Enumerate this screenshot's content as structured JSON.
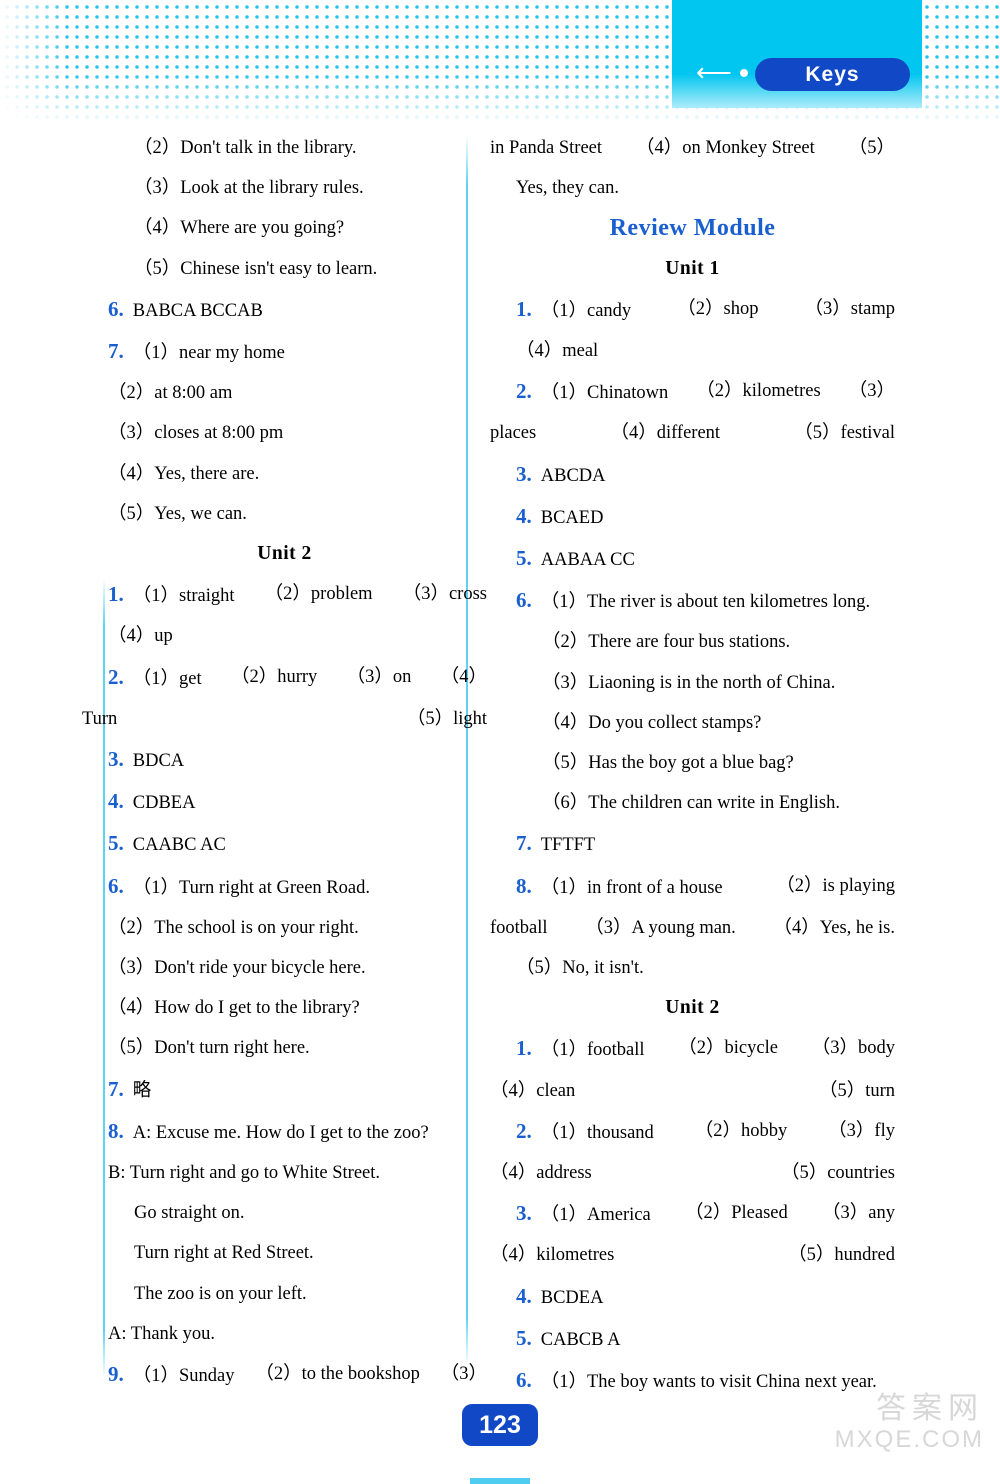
{
  "header": {
    "keys_label": "Keys",
    "back_icon": "back-arrow-icon",
    "accent_cyan": "#00c6f0",
    "accent_blue": "#1148c6"
  },
  "page_number": "123",
  "watermark": {
    "chinese": "答案网",
    "english": "MXQE.COM"
  },
  "left_column": [
    {
      "type": "line",
      "indent": 1,
      "text": "（2）Don't talk in the library."
    },
    {
      "type": "line",
      "indent": 1,
      "text": "（3）Look at the library rules."
    },
    {
      "type": "line",
      "indent": 1,
      "text": "（4）Where are you going?"
    },
    {
      "type": "line",
      "indent": 1,
      "text": "（5）Chinese isn't easy to learn."
    },
    {
      "type": "numbered",
      "num": "6.",
      "text": "BABCA   BCCAB"
    },
    {
      "type": "numbered",
      "num": "7.",
      "text": "（1）near my home"
    },
    {
      "type": "line",
      "indent": 0,
      "text": "（2）at 8:00 am"
    },
    {
      "type": "line",
      "indent": 0,
      "text": "（3）closes at 8:00 pm"
    },
    {
      "type": "line",
      "indent": 0,
      "text": "（4）Yes, there are."
    },
    {
      "type": "line",
      "indent": 0,
      "text": "（5）Yes, we can."
    },
    {
      "type": "unit",
      "text": "Unit 2"
    },
    {
      "type": "numbered-just",
      "num": "1.",
      "parts": [
        "（1）straight",
        "（2）problem",
        "（3）cross"
      ]
    },
    {
      "type": "line",
      "indent": 0,
      "text": "（4）up"
    },
    {
      "type": "numbered-just",
      "num": "2.",
      "parts": [
        "（1）get",
        "（2）hurry",
        "（3）on",
        "（4）"
      ]
    },
    {
      "type": "just2",
      "parts": [
        "Turn",
        "（5）light"
      ]
    },
    {
      "type": "numbered",
      "num": "3.",
      "text": "BDCA"
    },
    {
      "type": "numbered",
      "num": "4.",
      "text": "CDBEA"
    },
    {
      "type": "numbered",
      "num": "5.",
      "text": "CAABC   AC"
    },
    {
      "type": "numbered",
      "num": "6.",
      "text": "（1）Turn right at Green Road."
    },
    {
      "type": "line",
      "indent": 0,
      "text": "（2）The school is on your right."
    },
    {
      "type": "line",
      "indent": 0,
      "text": "（3）Don't ride your bicycle here."
    },
    {
      "type": "line",
      "indent": 0,
      "text": "（4）How do I get to the library?"
    },
    {
      "type": "line",
      "indent": 0,
      "text": "（5）Don't turn right here."
    },
    {
      "type": "numbered",
      "num": "7.",
      "text": "略"
    },
    {
      "type": "numbered",
      "num": "8.",
      "text": "A: Excuse me. How do I get to the zoo?"
    },
    {
      "type": "line",
      "indent": 0,
      "text": "B: Turn right and go to White Street."
    },
    {
      "type": "line",
      "indent": 1,
      "text": "Go straight on."
    },
    {
      "type": "line",
      "indent": 1,
      "text": "Turn right at Red Street."
    },
    {
      "type": "line",
      "indent": 1,
      "text": "The zoo is on your left."
    },
    {
      "type": "line",
      "indent": 0,
      "text": "A: Thank you."
    },
    {
      "type": "numbered-just",
      "num": "9.",
      "parts": [
        "（1）Sunday",
        "（2）to the bookshop",
        "（3）"
      ]
    }
  ],
  "right_column": [
    {
      "type": "just2",
      "parts": [
        "in Panda Street",
        "（4）on Monkey Street",
        "（5）"
      ]
    },
    {
      "type": "line",
      "indent": 0,
      "text": "Yes, they can."
    },
    {
      "type": "module",
      "text": "Review Module"
    },
    {
      "type": "unit",
      "text": "Unit 1"
    },
    {
      "type": "numbered-just",
      "num": "1.",
      "parts": [
        "（1）candy",
        "（2）shop",
        "（3）stamp"
      ]
    },
    {
      "type": "line",
      "indent": 0,
      "text": "（4）meal"
    },
    {
      "type": "numbered-just",
      "num": "2.",
      "parts": [
        "（1）Chinatown",
        "（2）kilometres",
        "（3）"
      ]
    },
    {
      "type": "just2",
      "parts": [
        "places",
        "（4）different",
        "（5）festival"
      ]
    },
    {
      "type": "numbered",
      "num": "3.",
      "text": "ABCDA"
    },
    {
      "type": "numbered",
      "num": "4.",
      "text": "BCAED"
    },
    {
      "type": "numbered",
      "num": "5.",
      "text": "AABAA CC"
    },
    {
      "type": "numbered",
      "num": "6.",
      "text": "（1）The river is about ten kilometres long."
    },
    {
      "type": "line",
      "indent": 1,
      "text": "（2）There are four bus stations."
    },
    {
      "type": "line",
      "indent": 1,
      "text": "（3）Liaoning is in the north of China."
    },
    {
      "type": "line",
      "indent": 1,
      "text": "（4）Do you collect stamps?"
    },
    {
      "type": "line",
      "indent": 1,
      "text": "（5）Has the boy got a blue bag?"
    },
    {
      "type": "line",
      "indent": 1,
      "text": "（6）The children can write in English."
    },
    {
      "type": "numbered",
      "num": "7.",
      "text": "TFTFT"
    },
    {
      "type": "numbered-just",
      "num": "8.",
      "parts": [
        "（1）in front of a house",
        "（2）is playing"
      ]
    },
    {
      "type": "just2",
      "parts": [
        "football",
        "（3）A young man.",
        "（4）Yes, he is."
      ]
    },
    {
      "type": "line",
      "indent": 0,
      "text": "（5）No, it isn't."
    },
    {
      "type": "unit",
      "text": "Unit 2"
    },
    {
      "type": "numbered-just",
      "num": "1.",
      "parts": [
        "（1）football",
        "（2）bicycle",
        "（3）body"
      ]
    },
    {
      "type": "just2",
      "parts": [
        "（4）clean",
        "（5）turn"
      ],
      "left": true
    },
    {
      "type": "numbered-just",
      "num": "2.",
      "parts": [
        "（1）thousand",
        "（2）hobby",
        "（3）fly"
      ]
    },
    {
      "type": "just2",
      "parts": [
        "（4）address",
        "（5）countries"
      ],
      "left": true
    },
    {
      "type": "numbered-just",
      "num": "3.",
      "parts": [
        "（1）America",
        "（2）Pleased",
        "（3）any"
      ]
    },
    {
      "type": "just2",
      "parts": [
        "（4）kilometres",
        "（5）hundred"
      ],
      "left": true
    },
    {
      "type": "numbered",
      "num": "4.",
      "text": "BCDEA"
    },
    {
      "type": "numbered",
      "num": "5.",
      "text": "CABCB   A"
    },
    {
      "type": "numbered",
      "num": "6.",
      "text": "（1）The boy wants to visit China next year."
    }
  ]
}
